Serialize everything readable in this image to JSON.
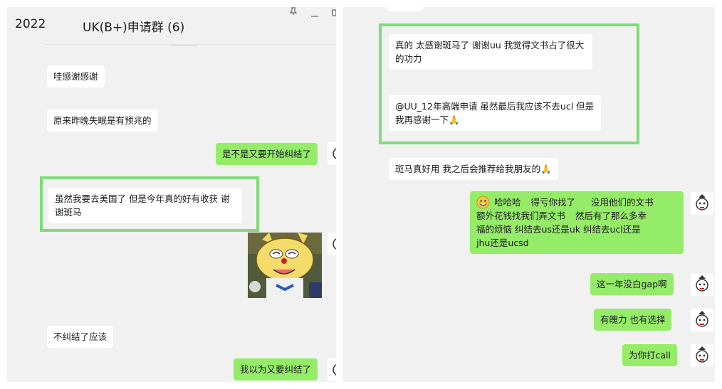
{
  "left_panel": {
    "header": {
      "year": "2022",
      "group_name": "UK(B+)申请群 (6)",
      "pin_icon": "pin-icon",
      "minimize_icon": "minimize-icon"
    },
    "messages": [
      {
        "type": "received",
        "text": "哇感谢感谢"
      },
      {
        "type": "received",
        "text": "原来昨晚失眠是有预兆的"
      },
      {
        "type": "sent",
        "text": "是不是又要开始纠结了"
      },
      {
        "type": "received",
        "text": "虽然我要去美国了 但是今年真的好有收获 谢谢斑马"
      },
      {
        "type": "sent_sticker",
        "sticker": "cartoon-cat-sticker"
      },
      {
        "type": "received",
        "text": "不纠结了应该"
      },
      {
        "type": "sent",
        "text": "我以为又要纠结了"
      }
    ]
  },
  "right_panel": {
    "messages": [
      {
        "type": "received",
        "text": "真的 太感谢斑马了 谢谢uu 我觉得文书占了很大的功力"
      },
      {
        "type": "received",
        "text": "@UU_12年高端申请 虽然最后我应该不去ucl 但是我再感谢一下🙏"
      },
      {
        "type": "received",
        "text": "斑马真好用 我之后会推荐给我朋友的🙏"
      },
      {
        "type": "sent",
        "lines": {
          "p1": "哈哈哈",
          "p2": "得亏你找了",
          "p3": "没用他们的文书",
          "p4": "额外花钱找我们弄文书",
          "p5": "然后有了那么多幸",
          "p6": "福的烦恼 纠结去us还是uk 纠结去ucl还是",
          "p7": "jhu还是ucsd"
        }
      },
      {
        "type": "sent",
        "text": "这一年没白gap啊"
      },
      {
        "type": "sent",
        "text": "有魄力 也有选择"
      },
      {
        "type": "sent",
        "text": "为你打call"
      }
    ]
  },
  "colors": {
    "sent_bubble": "#95ec69",
    "received_bubble": "#ffffff",
    "highlight_border": "#7fdc7a",
    "panel_background": "#f1f1f1"
  }
}
